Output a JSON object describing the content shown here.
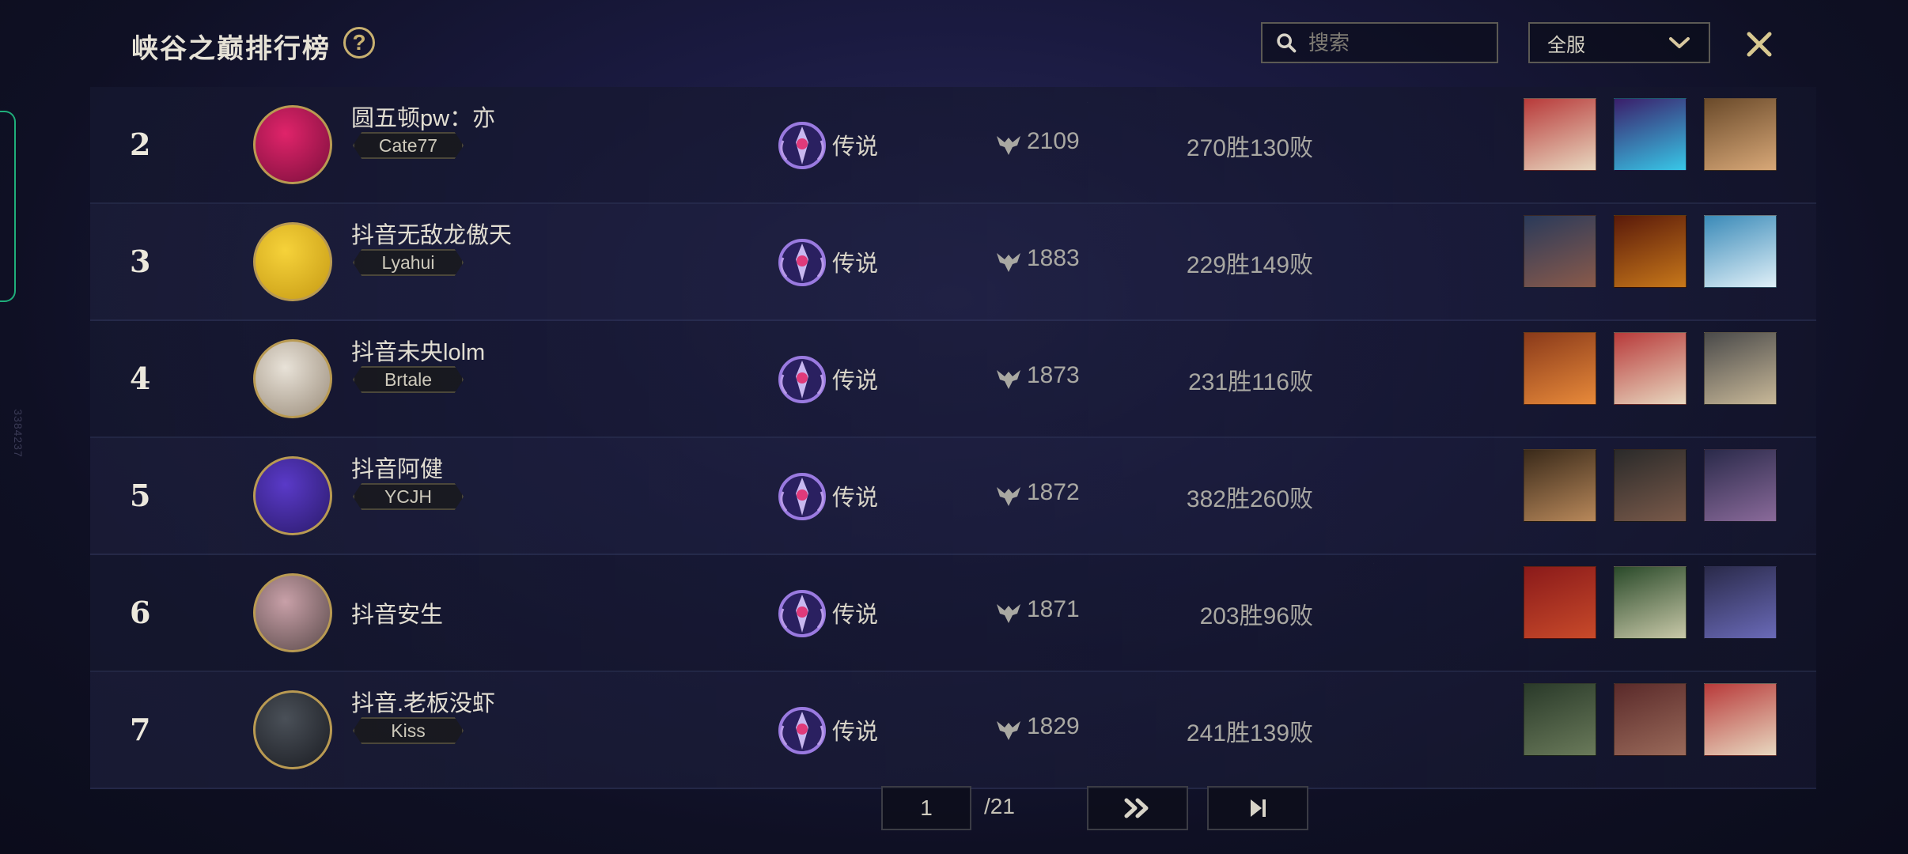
{
  "header": {
    "title": "峡谷之巅排行榜",
    "help_label": "?",
    "search_placeholder": "搜索",
    "server_selected": "全服"
  },
  "side": {
    "id_text": "3384237"
  },
  "rows": [
    {
      "rank": "2",
      "name": "圆五顿pw：亦",
      "tag": "Cate77",
      "tier": "传说",
      "score": "2109",
      "record": "270胜130败",
      "avatar_colors": [
        "#e0246a",
        "#7a0f3c"
      ],
      "champion_colors": [
        [
          "#b83a3a",
          "#e8d8c0"
        ],
        [
          "#3a1e6a",
          "#38c8e8"
        ],
        [
          "#6a4a2a",
          "#d8a878"
        ]
      ]
    },
    {
      "rank": "3",
      "name": "抖音无敌龙傲天",
      "tag": "Lyahui",
      "tier": "传说",
      "score": "1883",
      "record": "229胜149败",
      "avatar_colors": [
        "#f6d23a",
        "#c69a14"
      ],
      "champion_colors": [
        [
          "#2a3a5a",
          "#8a5a4a"
        ],
        [
          "#5a1a0a",
          "#c8781a"
        ],
        [
          "#3a8ab8",
          "#e0f0f8"
        ]
      ]
    },
    {
      "rank": "4",
      "name": "抖音未央lolm",
      "tag": "Brtale",
      "tier": "传说",
      "score": "1873",
      "record": "231胜116败",
      "avatar_colors": [
        "#e8e2d8",
        "#9a8c7a"
      ],
      "champion_colors": [
        [
          "#8a3a1a",
          "#e88a3a"
        ],
        [
          "#b83a3a",
          "#e8d8c0"
        ],
        [
          "#4a4a4a",
          "#c8b898"
        ]
      ]
    },
    {
      "rank": "5",
      "name": "抖音阿健",
      "tag": "YCJH",
      "tier": "传说",
      "score": "1872",
      "record": "382胜260败",
      "avatar_colors": [
        "#5a3ac8",
        "#2a1a6a"
      ],
      "champion_colors": [
        [
          "#3a2a1a",
          "#b8885a"
        ],
        [
          "#2a2a2a",
          "#7a5a4a"
        ],
        [
          "#2a2a4a",
          "#8a6a9a"
        ]
      ]
    },
    {
      "rank": "6",
      "name": "抖音安生",
      "tag": "",
      "tier": "传说",
      "score": "1871",
      "record": "203胜96败",
      "avatar_colors": [
        "#c8a0a8",
        "#5a4a4a"
      ],
      "champion_colors": [
        [
          "#8a1a1a",
          "#c84a2a"
        ],
        [
          "#2a4a2a",
          "#c8c8a8"
        ],
        [
          "#2a2a4a",
          "#6a6ab8"
        ]
      ]
    },
    {
      "rank": "7",
      "name": "抖音.老板没虾",
      "tag": "Kiss",
      "tier": "传说",
      "score": "1829",
      "record": "241胜139败",
      "avatar_colors": [
        "#4a5058",
        "#1a1c22"
      ],
      "champion_colors": [
        [
          "#2a3a2a",
          "#6a7a5a"
        ],
        [
          "#5a2a2a",
          "#9a6a5a"
        ],
        [
          "#b83a3a",
          "#e8d8c0"
        ]
      ]
    }
  ],
  "pagination": {
    "current": "1",
    "total": "/21"
  },
  "colors": {
    "gold": "#c8b070",
    "accent_green": "#1fae7a",
    "tier_purple": "#8a6adc"
  }
}
